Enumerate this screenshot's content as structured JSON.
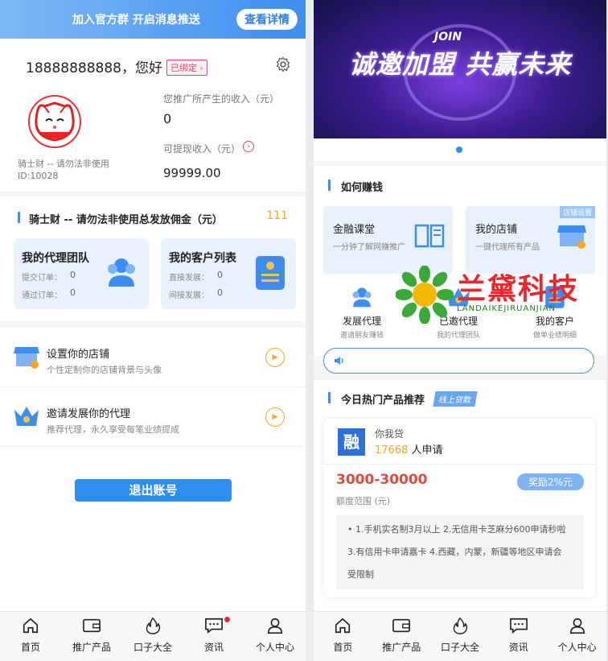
{
  "left": {
    "banner": {
      "text": "加入官方群 开启消息推送",
      "button": "查看详情"
    },
    "profile": {
      "phone": "18888888888，您好",
      "bound_label": "已绑定",
      "income_label": "您推广所产生的收入（元）",
      "income_value": "0",
      "withdraw_label": "可提现收入（元）",
      "withdraw_value": "99999.00",
      "uid": "骑士财 -- 请勿法非使用ID:10028"
    },
    "commission": {
      "title": "骑士财 -- 请勿法非使用总发放佣金（元）",
      "value": "111",
      "cards": [
        {
          "title": "我的代理团队",
          "l1": "提交订单：",
          "v1": "0",
          "l2": "通过订单：",
          "v2": "0"
        },
        {
          "title": "我的客户列表",
          "l1": "直接发展：",
          "v1": "0",
          "l2": "间接发展：",
          "v2": "0"
        }
      ]
    },
    "menu": [
      {
        "title": "设置你的店铺",
        "sub": "个性定制你的店铺背景与头像"
      },
      {
        "title": "邀请发展你的代理",
        "sub": "推荐代理，永久享受每笔业绩提成"
      }
    ],
    "logout": "退出账号"
  },
  "right": {
    "hero_text": "诚邀加盟 共赢未来",
    "hero_join": "JOIN",
    "earn": {
      "title": "如何赚钱",
      "cards": [
        {
          "title": "金融课堂",
          "sub": "一分钟了解网赚推广"
        },
        {
          "title": "我的店铺",
          "sub": "一键代理所有产品",
          "tag": "店铺设置"
        }
      ],
      "shortcuts": [
        {
          "title": "发展代理",
          "sub": "邀请朋友赚钱"
        },
        {
          "title": "已邀代理",
          "sub": "我的代理团队"
        },
        {
          "title": "我的客户",
          "sub": "做单业绩明细"
        }
      ]
    },
    "hot": {
      "title": "今日热门产品推荐",
      "tag": "线上贷款",
      "product": {
        "logo": "融",
        "name": "你我贷",
        "count": "17668",
        "apply_suffix": " 人申请",
        "range": "3000-30000",
        "range_label": "额度范围 (元)",
        "reward": "奖励2%元",
        "desc1": "• 1.手机实名制3月以上 2.无信用卡芝麻分600申请秒啦",
        "desc2": "3.有信用卡申请嘉卡 4.西藏，内蒙，新疆等地区申请会",
        "desc3": "受限制"
      }
    },
    "watermark": {
      "cn": "兰黛科技",
      "en": "LANDAIKEJIRUANJIAN"
    }
  },
  "tabs": [
    "首页",
    "推广产品",
    "口子大全",
    "资讯",
    "个人中心"
  ],
  "colors": {
    "accent": "#2f8ff0",
    "orange": "#f5a623",
    "pink": "#e0457b",
    "red": "#e24b3a"
  }
}
